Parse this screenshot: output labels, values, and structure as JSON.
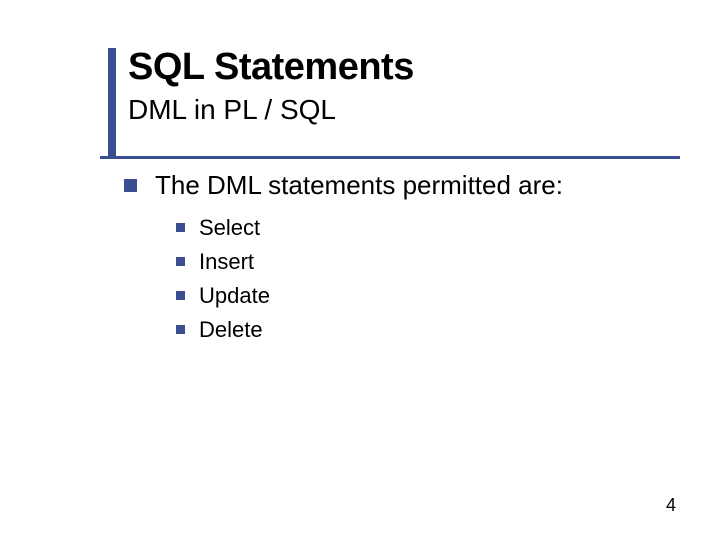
{
  "colors": {
    "accent": "#3b4e8f"
  },
  "title": "SQL Statements",
  "subtitle": "DML in PL / SQL",
  "body": {
    "heading": "The DML statements permitted are:",
    "items": [
      "Select",
      "Insert",
      "Update",
      "Delete"
    ]
  },
  "page_number": "4"
}
